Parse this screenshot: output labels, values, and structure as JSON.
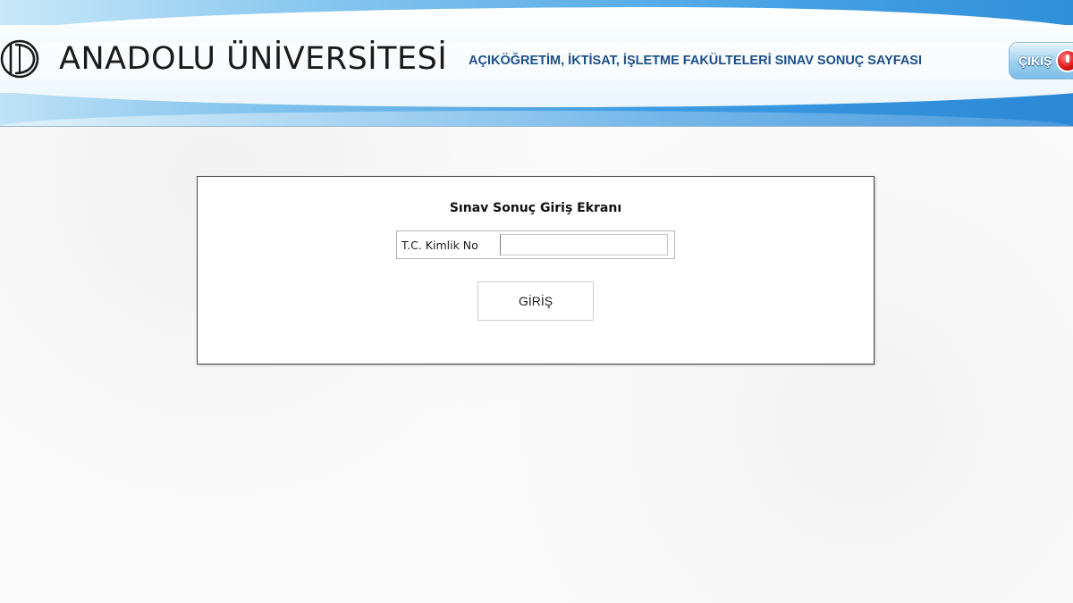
{
  "header": {
    "university_name": "ANADOLU ÜNİVERSİTESİ",
    "faculty_title": "AÇIKÖĞRETİM, İKTİSAT, İŞLETME FAKÜLTELERİ SINAV SONUÇ SAYFASI",
    "exit_label": "ÇIKIŞ",
    "exit_icon": "power-icon",
    "logo_icon": "anadolu-university-logo"
  },
  "login_panel": {
    "title": "Sınav Sonuç Giriş Ekranı",
    "id_label": "T.C. Kimlik No",
    "id_value": "",
    "submit_label": "GİRİŞ"
  },
  "colors": {
    "header_accent": "#2f8fd9",
    "faculty_title": "#1b4f8a",
    "exit_icon": "#e01818"
  }
}
